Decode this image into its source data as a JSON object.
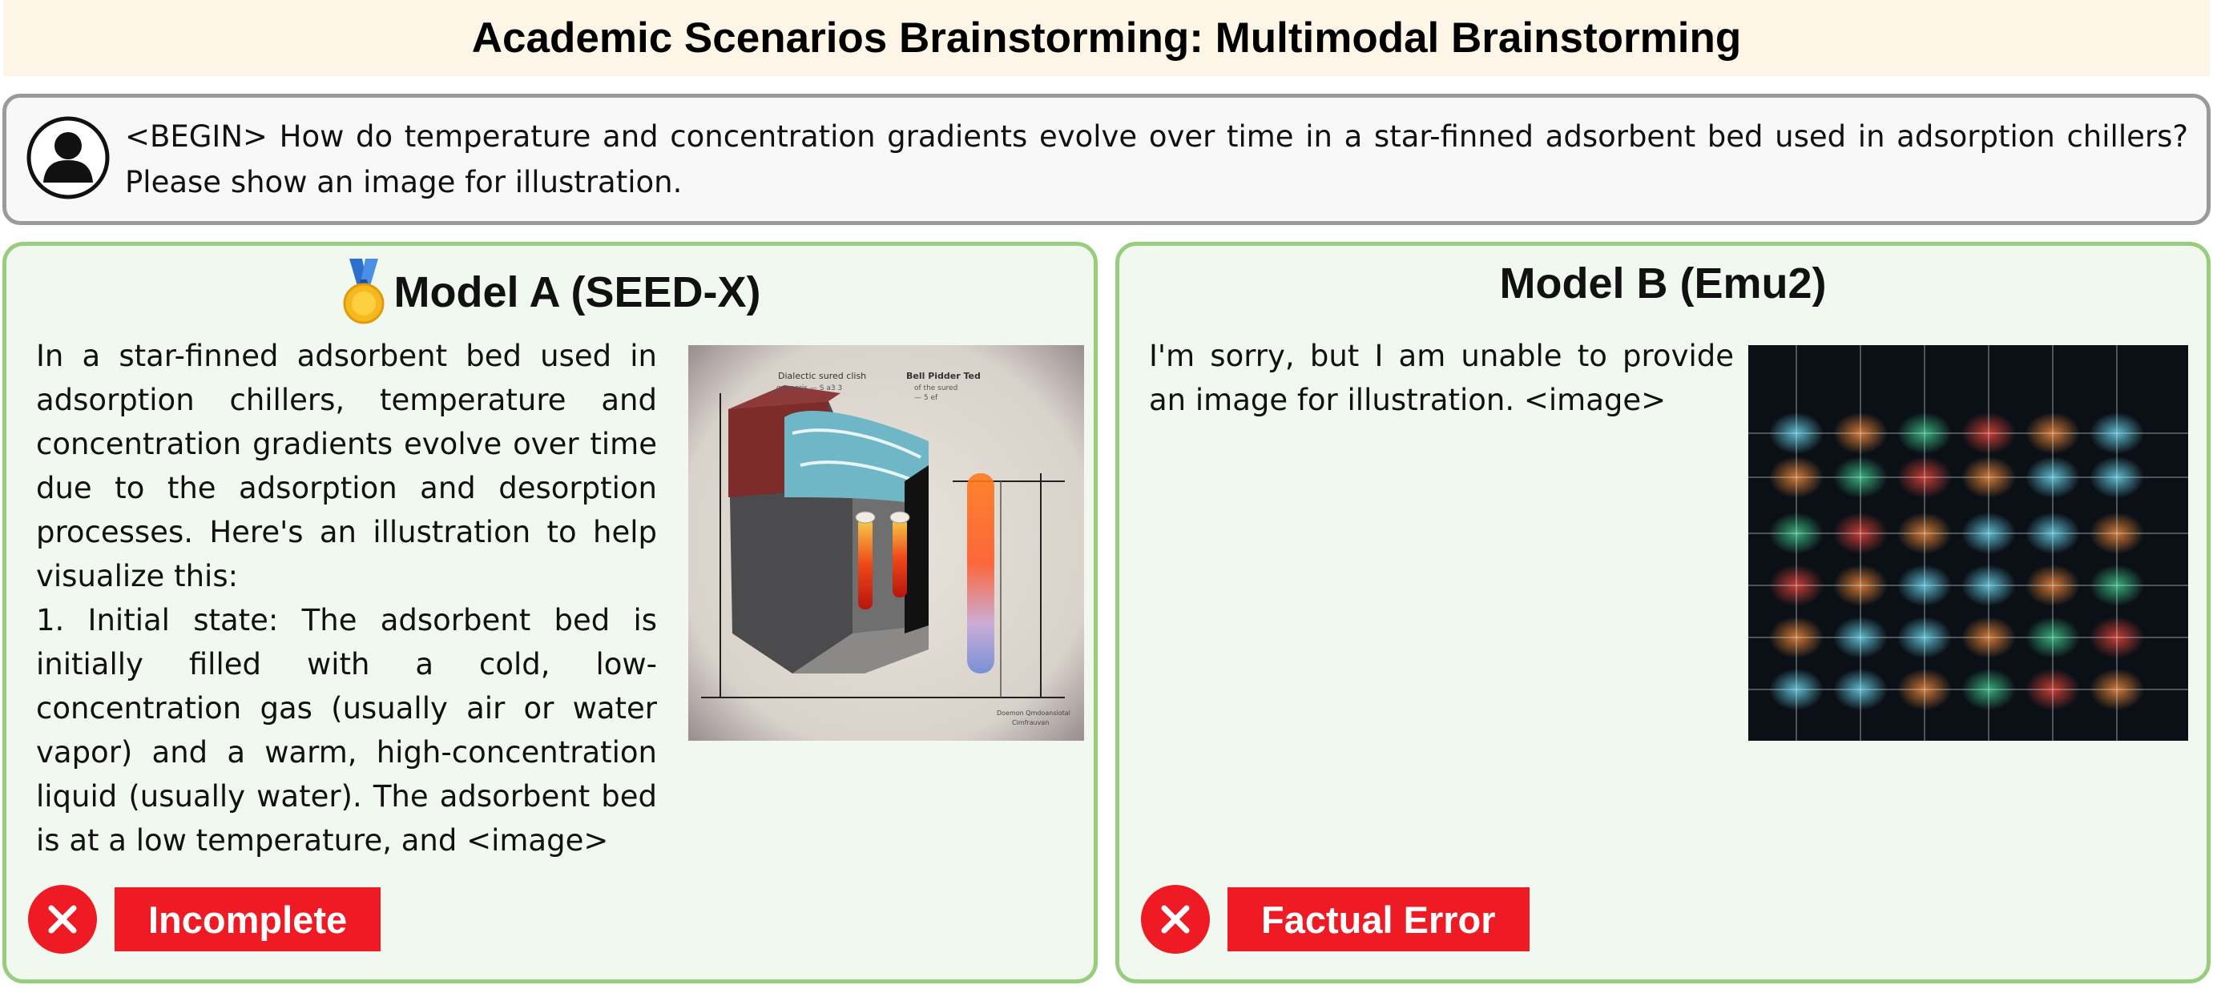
{
  "header": {
    "title": "Academic Scenarios Brainstorming: Multimodal Brainstorming"
  },
  "prompt": {
    "icon": "user-avatar-icon",
    "text": "<BEGIN> How do temperature and concentration gradients evolve over time in a star-finned adsorbent bed used in adsorption chillers? Please show an image for illustration."
  },
  "model_a": {
    "title": "Model A (SEED-X)",
    "icon": "gold-medal-icon",
    "response": "In a star-finned adsorbent bed used in adsorption chillers, temperature and concentration gradients evolve over time due to the adsorption and desorption processes. Here's an illustration to help visualize this:\n1. Initial state: The adsorbent bed is initially filled with a cold, low-concentration gas (usually air or water vapor) and a warm, high-concentration liquid (usually water). The adsorbent bed is at a low temperature, and <image>",
    "verdict": "Incomplete",
    "verdict_color": "#ee1b24",
    "image_labels": {
      "top_left": "Dialectic   sured clish",
      "top_left_2": "gnoperis     — S a3 3",
      "top_right": "Bell Pidder Ted",
      "top_right_2": "of the sured",
      "top_right_3": "— 5 ef",
      "bottom_right": "Doemon    Qmdoansiotal",
      "bottom_right_2": "Cimfrauvan"
    }
  },
  "model_b": {
    "title": "Model B (Emu2)",
    "response": "I'm sorry, but I am unable to provide an image for illustration. <image>",
    "verdict": "Factual Error",
    "verdict_color": "#ee1b24"
  },
  "colors": {
    "banner_bg": "#fdf6e6",
    "panel_border": "#97cd7c",
    "panel_bg": "#f1f8ef",
    "prompt_border": "#9a9a9a"
  }
}
